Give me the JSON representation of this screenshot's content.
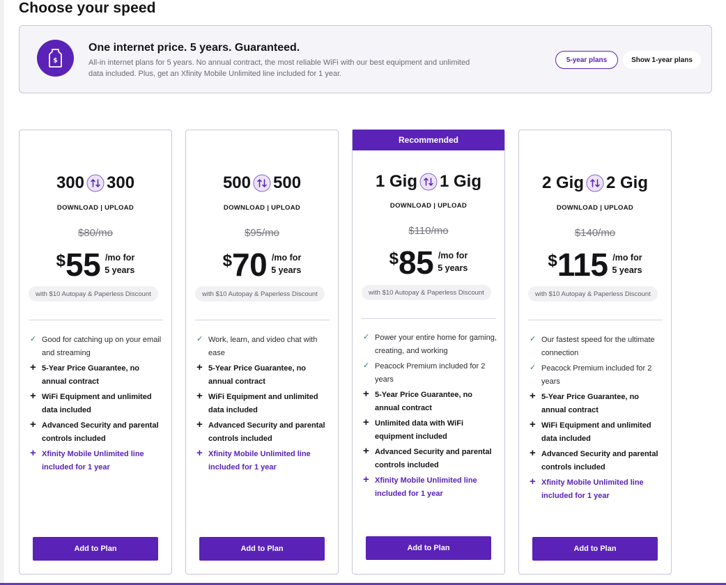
{
  "page": {
    "heading": "Choose your speed"
  },
  "banner": {
    "icon": "price-tag-icon",
    "title": "One internet price. 5 years. Guaranteed.",
    "text": "All-in internet plans for 5 years. No annual contract, the most reliable WiFi with our best equipment and unlimited data included. Plus, get an Xfinity Mobile Unlimited line included for 1 year.",
    "toggle_active": "5-year plans",
    "toggle_inactive": "Show 1-year plans"
  },
  "colors": {
    "brand": "#5a22b7",
    "check": "#1f8a52",
    "border": "#c9c5d8"
  },
  "plans": [
    {
      "download": "300",
      "upload": "300",
      "speed_label": "DOWNLOAD | UPLOAD",
      "old_price": "$80/mo",
      "dollar": "$",
      "price": "55",
      "per_line1": "/mo for",
      "per_line2": "5 years",
      "discount": "with $10 Autopay & Paperless Discount",
      "features": [
        {
          "type": "check",
          "text": "Good for catching up on your email and streaming"
        },
        {
          "type": "plus",
          "text": "5-Year Price Guarantee, no annual contract"
        },
        {
          "type": "plus",
          "text": "WiFi Equipment and unlimited data included"
        },
        {
          "type": "plus",
          "text": "Advanced Security and parental controls included"
        },
        {
          "type": "purple",
          "text": "Xfinity Mobile Unlimited line included for 1 year"
        }
      ],
      "button": "Add to Plan"
    },
    {
      "download": "500",
      "upload": "500",
      "speed_label": "DOWNLOAD | UPLOAD",
      "old_price": "$95/mo",
      "dollar": "$",
      "price": "70",
      "per_line1": "/mo for",
      "per_line2": "5 years",
      "discount": "with $10 Autopay & Paperless Discount",
      "features": [
        {
          "type": "check",
          "text": "Work, learn, and video chat with ease"
        },
        {
          "type": "plus",
          "text": "5-Year Price Guarantee, no annual contract"
        },
        {
          "type": "plus",
          "text": "WiFi Equipment and unlimited data included"
        },
        {
          "type": "plus",
          "text": "Advanced Security and parental controls included"
        },
        {
          "type": "purple",
          "text": "Xfinity Mobile Unlimited line included for 1 year"
        }
      ],
      "button": "Add to Plan"
    },
    {
      "recommended": "Recommended",
      "download": "1 Gig",
      "upload": "1 Gig",
      "speed_label": "DOWNLOAD | UPLOAD",
      "old_price": "$110/mo",
      "dollar": "$",
      "price": "85",
      "per_line1": "/mo for",
      "per_line2": "5 years",
      "discount": "with $10 Autopay & Paperless Discount",
      "features": [
        {
          "type": "check",
          "text": "Power your entire home for gaming, creating, and working"
        },
        {
          "type": "check",
          "text": "Peacock Premium included for 2 years"
        },
        {
          "type": "plus",
          "text": "5-Year Price Guarantee, no annual contract"
        },
        {
          "type": "plus",
          "text": "Unlimited data with WiFi equipment included"
        },
        {
          "type": "plus",
          "text": "Advanced Security and parental controls included"
        },
        {
          "type": "purple",
          "text": "Xfinity Mobile Unlimited line included for 1 year"
        }
      ],
      "button": "Add to Plan"
    },
    {
      "download": "2 Gig",
      "upload": "2 Gig",
      "speed_label": "DOWNLOAD | UPLOAD",
      "old_price": "$140/mo",
      "dollar": "$",
      "price": "115",
      "per_line1": "/mo for",
      "per_line2": "5 years",
      "discount": "with $10 Autopay & Paperless Discount",
      "features": [
        {
          "type": "check",
          "text": "Our fastest speed for the ultimate connection"
        },
        {
          "type": "check",
          "text": "Peacock Premium included for 2 years"
        },
        {
          "type": "plus",
          "text": "5-Year Price Guarantee, no annual contract"
        },
        {
          "type": "plus",
          "text": "WiFi Equipment and unlimited data included"
        },
        {
          "type": "plus",
          "text": "Advanced Security and parental controls included"
        },
        {
          "type": "purple",
          "text": "Xfinity Mobile Unlimited line included for 1 year"
        }
      ],
      "button": "Add to Plan"
    }
  ]
}
